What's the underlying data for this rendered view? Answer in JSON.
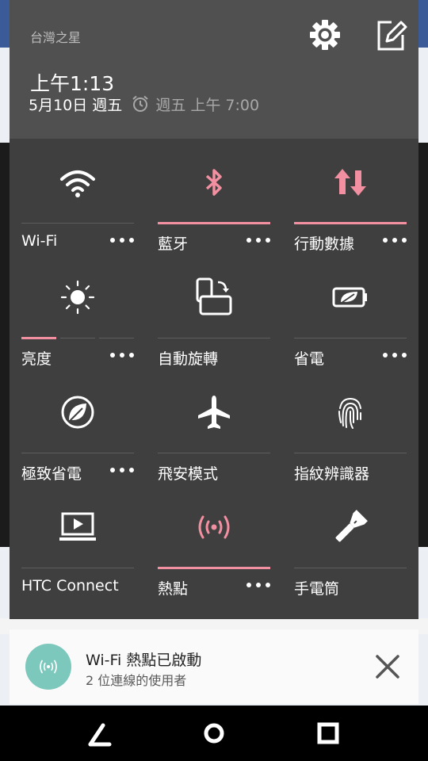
{
  "status": {
    "carrier": "台灣之星",
    "time": "上午1:13",
    "date": "5月10日 週五",
    "alarm": "週五 上午 7:00"
  },
  "header_icons": {
    "settings": "gear-icon",
    "edit": "edit-icon"
  },
  "quick_settings": [
    {
      "label": "Wi-Fi",
      "icon": "wifi-icon",
      "active": false,
      "has_more": true
    },
    {
      "label": "藍牙",
      "icon": "bluetooth-icon",
      "active": true,
      "has_more": true
    },
    {
      "label": "行動數據",
      "icon": "mobile-data-icon",
      "active": true,
      "has_more": true
    },
    {
      "label": "亮度",
      "icon": "brightness-icon",
      "level": 0.33,
      "has_more": true
    },
    {
      "label": "自動旋轉",
      "icon": "auto-rotate-icon",
      "active": false,
      "has_more": false
    },
    {
      "label": "省電",
      "icon": "power-saver-icon",
      "active": false,
      "has_more": true
    },
    {
      "label": "極致省電",
      "icon": "extreme-power-saver-icon",
      "active": false,
      "has_more": true
    },
    {
      "label": "飛安模式",
      "icon": "airplane-icon",
      "active": false,
      "has_more": false
    },
    {
      "label": "指紋辨識器",
      "icon": "fingerprint-icon",
      "active": false,
      "has_more": false
    },
    {
      "label": "HTC Connect",
      "icon": "htc-connect-icon",
      "active": false,
      "has_more": false
    },
    {
      "label": "熱點",
      "icon": "hotspot-icon",
      "active": true,
      "has_more": true
    },
    {
      "label": "手電筒",
      "icon": "flashlight-icon",
      "active": false,
      "has_more": false
    }
  ],
  "notification": {
    "title": "Wi-Fi 熱點已啟動",
    "subtitle": "2 位連線的使用者",
    "icon": "hotspot-icon"
  },
  "nav": [
    "back-icon",
    "home-icon",
    "recents-icon"
  ],
  "colors": {
    "accent": "#f28fa1",
    "header_bg": "#505050",
    "panel_bg": "#3f3f3f",
    "notification_icon_bg": "#7dc8bc"
  }
}
